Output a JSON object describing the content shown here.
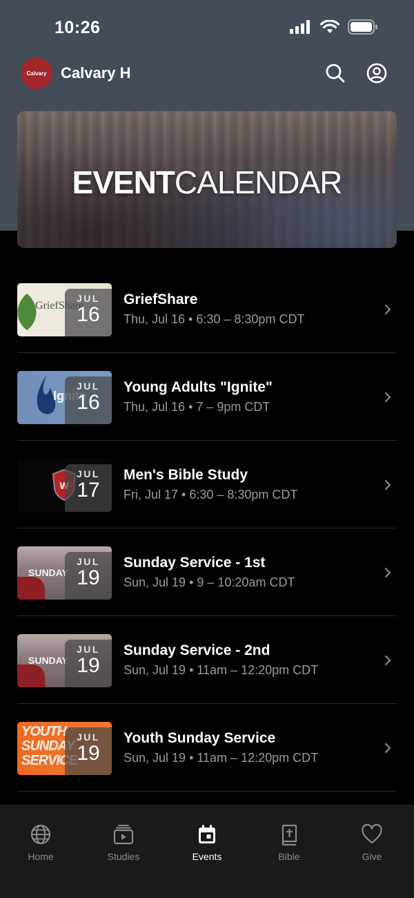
{
  "status_bar": {
    "time": "10:26"
  },
  "header": {
    "logo_text": "Calvary",
    "title": "Calvary H"
  },
  "banner": {
    "title_bold": "EVENT",
    "title_light": "CALENDAR"
  },
  "events": [
    {
      "title": "GriefShare",
      "meta": "Thu, Jul 16 • 6:30 – 8:30pm CDT",
      "month": "JUL",
      "day": "16",
      "thumb_text": "GriefShare"
    },
    {
      "title": "Young Adults \"Ignite\"",
      "meta": "Thu, Jul 16 • 7 – 9pm CDT",
      "month": "JUL",
      "day": "16",
      "thumb_text": "Ignite"
    },
    {
      "title": "Men's Bible Study",
      "meta": "Fri, Jul 17 • 6:30 – 8:30pm CDT",
      "month": "JUL",
      "day": "17",
      "thumb_text": ""
    },
    {
      "title": "Sunday Service - 1st",
      "meta": "Sun, Jul 19 • 9 – 10:20am CDT",
      "month": "JUL",
      "day": "19",
      "thumb_text": "SUNDAY"
    },
    {
      "title": "Sunday Service - 2nd",
      "meta": "Sun, Jul 19 • 11am – 12:20pm CDT",
      "month": "JUL",
      "day": "19",
      "thumb_text": "SUNDAY"
    },
    {
      "title": "Youth Sunday Service",
      "meta": "Sun, Jul 19 • 11am – 12:20pm CDT",
      "month": "JUL",
      "day": "19",
      "thumb_text": "YOUTH SUNDAY SERVICE"
    }
  ],
  "tabbar": {
    "tabs": [
      {
        "label": "Home",
        "icon": "globe-icon"
      },
      {
        "label": "Studies",
        "icon": "video-stack-icon"
      },
      {
        "label": "Events",
        "icon": "calendar-icon",
        "active": true
      },
      {
        "label": "Bible",
        "icon": "bible-icon"
      },
      {
        "label": "Give",
        "icon": "heart-icon"
      }
    ]
  },
  "colors": {
    "header_bg": "#444c57",
    "logo_bg": "#a3282c",
    "background": "#000000",
    "tabbar_bg": "#1a1a1a",
    "muted_text": "#9b9b9b"
  }
}
